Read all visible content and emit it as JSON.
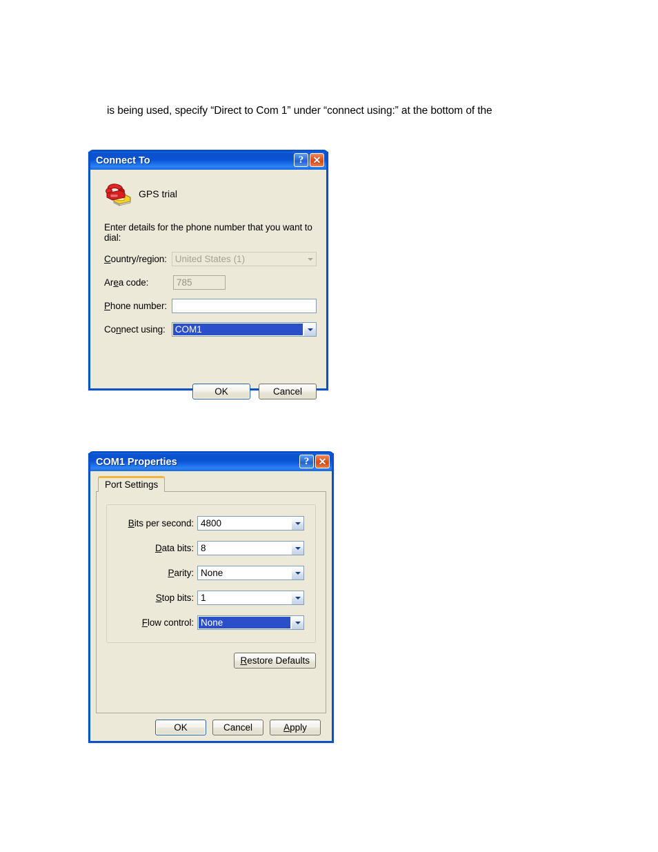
{
  "document": {
    "paragraph": "is being used, specify “Direct to Com 1” under “connect using:” at the bottom of the"
  },
  "colors": {
    "titlebar_blue": "#0b52d0",
    "dialog_face": "#ece9d8",
    "selection_blue": "#2a4fc8",
    "tab_accent_orange": "#f5b43c",
    "close_button_red": "#d44c18"
  },
  "connect_to_dialog": {
    "title": "Connect To",
    "caption_buttons": {
      "help": "?",
      "close": "✕"
    },
    "connection_name": "GPS trial",
    "icon": "telephone-modem-icon",
    "prompt": "Enter details for the phone number that you want to dial:",
    "fields": [
      {
        "label_prefix": "",
        "label_accel": "C",
        "label_suffix": "ountry/region:",
        "control": "combobox",
        "value": "United States (1)",
        "disabled": true,
        "selected": false
      },
      {
        "label_prefix": "Ar",
        "label_accel": "e",
        "label_suffix": "a code:",
        "control": "textbox",
        "value": "785",
        "disabled": true,
        "selected": false
      },
      {
        "label_prefix": "",
        "label_accel": "P",
        "label_suffix": "hone number:",
        "control": "textbox",
        "value": "",
        "disabled": false,
        "selected": false
      },
      {
        "label_prefix": "Co",
        "label_accel": "n",
        "label_suffix": "nect using:",
        "control": "combobox",
        "value": "COM1",
        "disabled": false,
        "selected": true
      }
    ],
    "buttons": [
      {
        "label": "OK",
        "default": true
      },
      {
        "label": "Cancel",
        "default": false
      }
    ]
  },
  "com1_properties_dialog": {
    "title": "COM1 Properties",
    "caption_buttons": {
      "help": "?",
      "close": "✕"
    },
    "tabs": [
      {
        "label": "Port Settings",
        "active": true
      }
    ],
    "settings": [
      {
        "label_accel": "B",
        "label_suffix": "its per second:",
        "value": "4800",
        "selected": false
      },
      {
        "label_accel": "D",
        "label_suffix": "ata bits:",
        "value": "8",
        "selected": false
      },
      {
        "label_accel": "P",
        "label_suffix": "arity:",
        "value": "None",
        "selected": false
      },
      {
        "label_accel": "S",
        "label_suffix": "top bits:",
        "value": "1",
        "selected": false
      },
      {
        "label_accel": "F",
        "label_suffix": "low control:",
        "value": "None",
        "selected": true
      }
    ],
    "restore_defaults": {
      "accel": "R",
      "suffix": "estore Defaults"
    },
    "buttons": [
      {
        "label": "OK",
        "default": true,
        "accel": ""
      },
      {
        "label": "Cancel",
        "default": false,
        "accel": ""
      },
      {
        "label_accel": "A",
        "label_suffix": "pply",
        "default": false
      }
    ]
  }
}
